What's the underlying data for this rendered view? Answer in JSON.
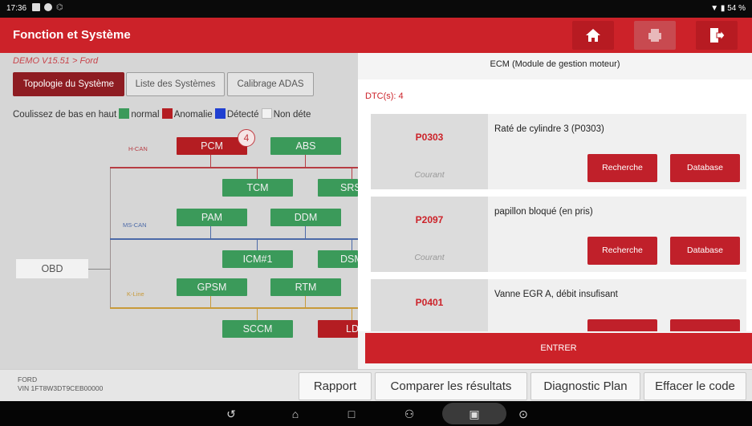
{
  "status_bar": {
    "time": "17:36",
    "battery": "▼ ▮ 54 %"
  },
  "header": {
    "title": "Fonction et Système",
    "icons": [
      "home-icon",
      "print-icon",
      "exit-icon"
    ]
  },
  "left_panel": {
    "breadcrumb": "DEMO V15.51 > Ford",
    "tabs": [
      {
        "label": "Topologie du Système",
        "active": true
      },
      {
        "label": "Liste des Systèmes",
        "active": false
      },
      {
        "label": "Calibrage ADAS",
        "active": false
      }
    ],
    "legend": {
      "intro": "Coulissez de bas en haut",
      "items": [
        {
          "label": "normal",
          "color": "#3b9a5a"
        },
        {
          "label": "Anomalie",
          "color": "#b41d22"
        },
        {
          "label": "Détecté",
          "color": "#1f3fd1"
        },
        {
          "label": "Non déte",
          "color": "#f2f2f2"
        }
      ]
    },
    "obd_label": "OBD",
    "buses": {
      "hcan": "H-CAN",
      "mscan": "MS-CAN",
      "kline": "K-Line"
    },
    "modules": {
      "pcm": "PCM",
      "pcm_badge": "4",
      "abs": "ABS",
      "tcm": "TCM",
      "srs": "SRS",
      "pam": "PAM",
      "ddm": "DDM",
      "icm": "ICM#1",
      "dsm": "DSM",
      "gpsm": "GPSM",
      "rtm": "RTM",
      "sccm": "SCCM",
      "ldw": "LDW"
    }
  },
  "right_panel": {
    "title": "ECM (Module de gestion moteur)",
    "dtc_count": "DTC(s): 4",
    "dtcs": [
      {
        "code": "P0303",
        "description": "Raté de cylindre 3 (P0303)",
        "status": "Courant",
        "btn_search": "Recherche",
        "btn_db": "Database"
      },
      {
        "code": "P2097",
        "description": "papillon bloqué (en pris)",
        "status": "Courant",
        "btn_search": "Recherche",
        "btn_db": "Database"
      },
      {
        "code": "P0401",
        "description": "Vanne EGR A, débit insufisant",
        "status": "",
        "btn_search": "",
        "btn_db": ""
      }
    ],
    "enter_label": "ENTRER"
  },
  "bottom_bar": {
    "make": "FORD",
    "vin": "VIN 1FT8W3DT9CEB00000",
    "buttons": [
      "Rapport",
      "Comparer les résultats",
      "Diagnostic Plan",
      "Effacer le code"
    ]
  },
  "colors": {
    "brand_red": "#cc2229",
    "normal_green": "#3b9a5a",
    "anomaly_red": "#b41d22"
  }
}
